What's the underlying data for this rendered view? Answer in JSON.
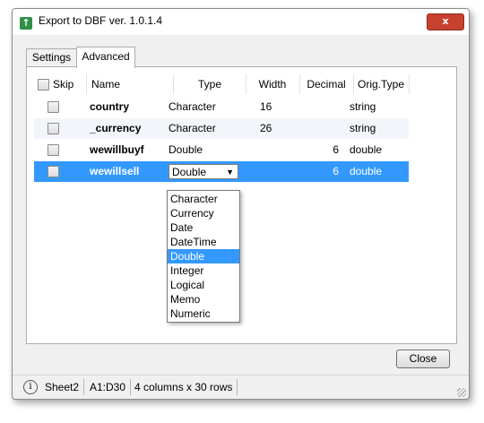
{
  "window": {
    "title": "Export to DBF  ver. 1.0.1.4",
    "app_icon": "↑",
    "close_glyph": "x"
  },
  "tabs": [
    {
      "label": "Settings"
    },
    {
      "label": "Advanced"
    }
  ],
  "grid": {
    "headers": {
      "skip": "Skip",
      "name": "Name",
      "type": "Type",
      "width": "Width",
      "decimal": "Decimal",
      "orig_type": "Orig.Type"
    },
    "rows": [
      {
        "name": "country",
        "type": "Character",
        "width": "16",
        "decimal": "",
        "orig_type": "string"
      },
      {
        "name": "_currency",
        "type": "Character",
        "width": "26",
        "decimal": "",
        "orig_type": "string"
      },
      {
        "name": "wewillbuyf",
        "type": "Double",
        "width": "",
        "decimal": "6",
        "orig_type": "double"
      },
      {
        "name": "wewillsell",
        "type": "Double",
        "width": "",
        "decimal": "6",
        "orig_type": "double"
      }
    ],
    "selected_row": 3
  },
  "type_dropdown": {
    "selected": "Double",
    "arrow": "▼",
    "options": [
      "Character",
      "Currency",
      "Date",
      "DateTime",
      "Double",
      "Integer",
      "Logical",
      "Memo",
      "Numeric"
    ]
  },
  "buttons": {
    "close": "Close"
  },
  "status": {
    "info_icon": "i",
    "sheet": "Sheet2",
    "range": "A1:D30",
    "size": "4 columns x 30 rows"
  },
  "colors": {
    "selection": "#3399ff",
    "app_icon": "#2f8f46",
    "close_button": "#c7412f"
  }
}
